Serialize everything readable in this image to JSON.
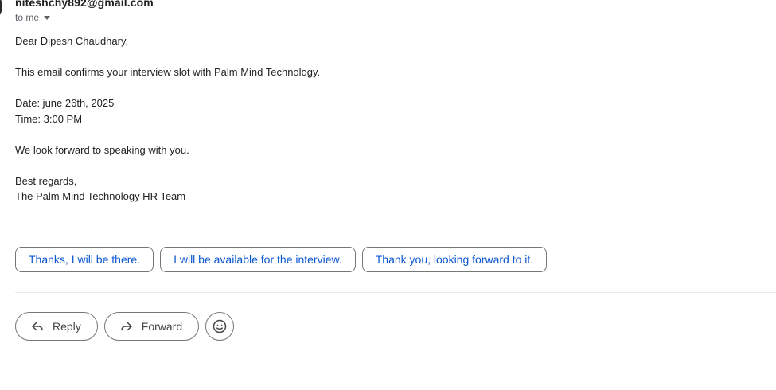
{
  "header": {
    "sender_email": "niteshchy892@gmail.com",
    "recipient_label": "to me"
  },
  "message": {
    "greeting": "Dear Dipesh Chaudhary,",
    "line_confirm": "This email confirms your interview slot with Palm Mind Technology.",
    "date": "Date: june 26th, 2025",
    "time": "Time: 3:00 PM",
    "closing_line": "We look forward to speaking with you.",
    "signoff": "Best regards,",
    "signature": "The Palm Mind Technology HR Team"
  },
  "smart_replies": [
    "Thanks, I will be there.",
    "I will be available for the interview.",
    "Thank you, looking forward to it."
  ],
  "actions": {
    "reply_label": "Reply",
    "forward_label": "Forward",
    "reply_icon": "reply-icon",
    "forward_icon": "forward-icon",
    "emoji_icon": "emoji-icon"
  },
  "colors": {
    "chip_text": "#0b57d0",
    "border": "#747775"
  }
}
